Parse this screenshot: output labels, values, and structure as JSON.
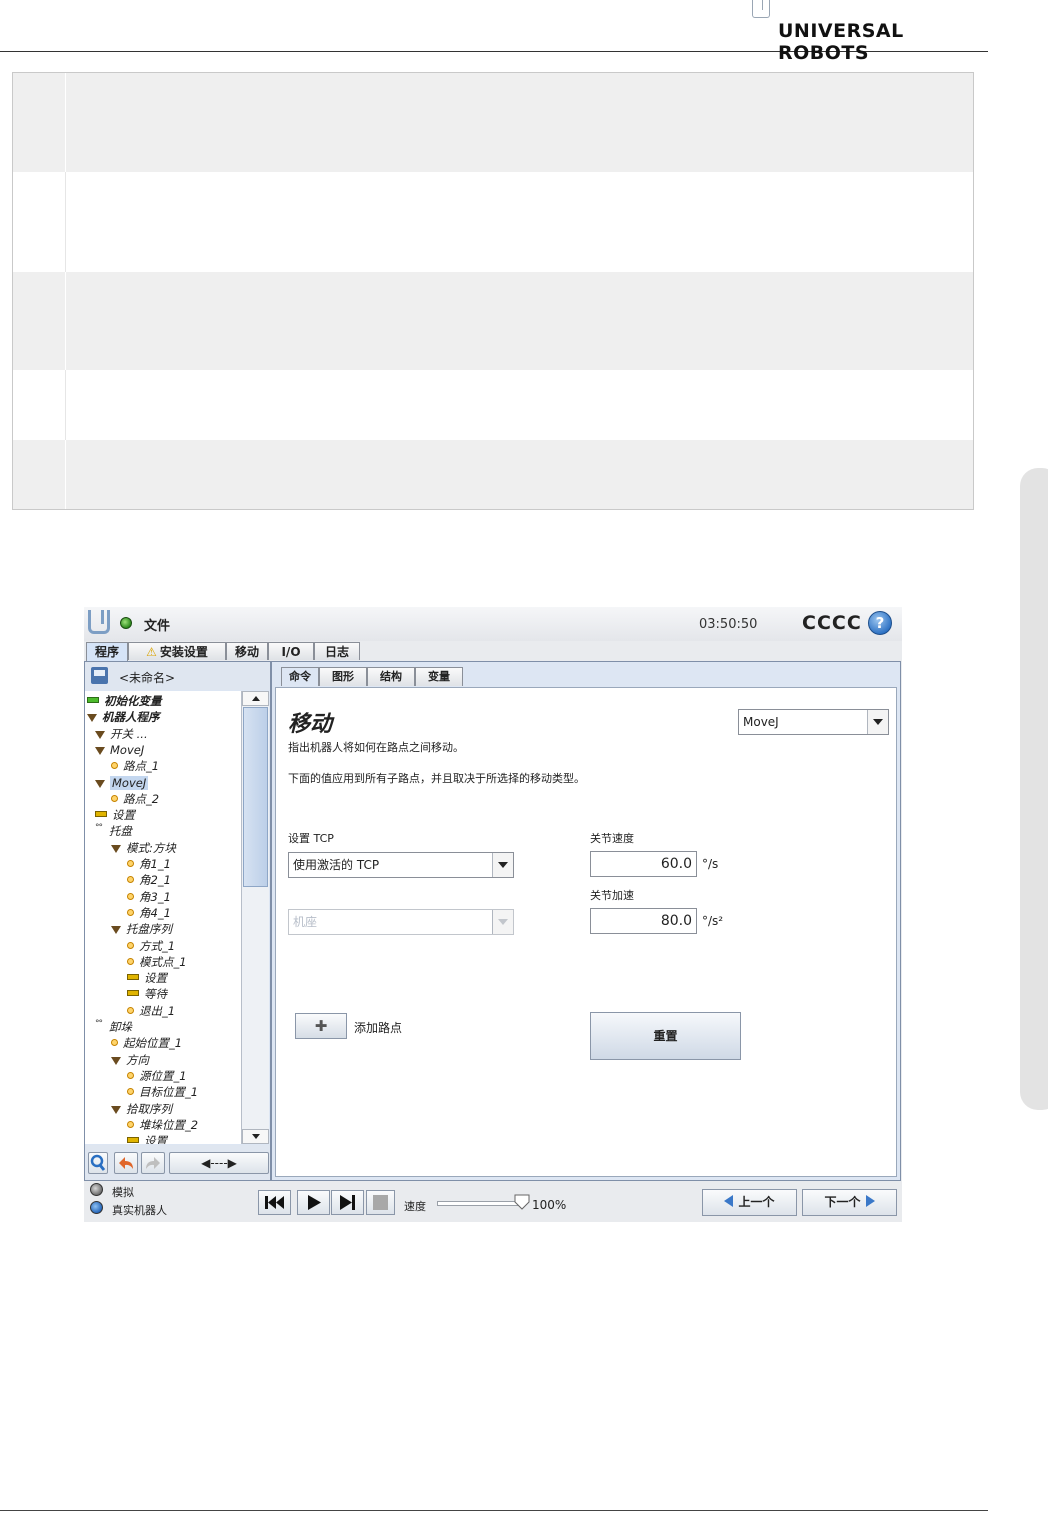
{
  "manual": {
    "brand": "UNIVERSAL ROBOTS"
  },
  "topbar": {
    "file_menu": "文件",
    "clock": "03:50:50",
    "robot_name": "CCCC",
    "help_symbol": "?"
  },
  "main_tabs": [
    {
      "label": "程序"
    },
    {
      "label": "安装设置",
      "warning": true
    },
    {
      "label": "移动"
    },
    {
      "label": "I/O"
    },
    {
      "label": "日志"
    }
  ],
  "program": {
    "name": "<未命名>"
  },
  "tree": [
    {
      "label": "初始化变量",
      "icon": "bar-green",
      "indent": 0,
      "bold": true
    },
    {
      "label": "机器人程序",
      "icon": "triangle",
      "indent": 0,
      "bold": true
    },
    {
      "label": "开关 ...",
      "icon": "triangle",
      "indent": 1
    },
    {
      "label": "MoveJ",
      "icon": "triangle",
      "indent": 1
    },
    {
      "label": "路点_1",
      "icon": "dot",
      "indent": 2
    },
    {
      "label": "MoveJ",
      "icon": "triangle",
      "indent": 1,
      "selected": true
    },
    {
      "label": "路点_2",
      "icon": "dot",
      "indent": 2
    },
    {
      "label": "设置",
      "icon": "bar",
      "indent": 1
    },
    {
      "label": "托盘",
      "icon": "node",
      "indent": 1
    },
    {
      "label": "模式:方块",
      "icon": "triangle",
      "indent": 2
    },
    {
      "label": "角1_1",
      "icon": "dot",
      "indent": 3
    },
    {
      "label": "角2_1",
      "icon": "dot",
      "indent": 3
    },
    {
      "label": "角3_1",
      "icon": "dot",
      "indent": 3
    },
    {
      "label": "角4_1",
      "icon": "dot",
      "indent": 3
    },
    {
      "label": "托盘序列",
      "icon": "triangle",
      "indent": 2
    },
    {
      "label": "方式_1",
      "icon": "dot",
      "indent": 3
    },
    {
      "label": "模式点_1",
      "icon": "dot",
      "indent": 3
    },
    {
      "label": "设置",
      "icon": "bar",
      "indent": 3
    },
    {
      "label": "等待",
      "icon": "bar",
      "indent": 3
    },
    {
      "label": "退出_1",
      "icon": "dot",
      "indent": 3
    },
    {
      "label": "卸垛",
      "icon": "node",
      "indent": 1
    },
    {
      "label": "起始位置_1",
      "icon": "dot",
      "indent": 2
    },
    {
      "label": "方向",
      "icon": "triangle",
      "indent": 2
    },
    {
      "label": "源位置_1",
      "icon": "dot",
      "indent": 3
    },
    {
      "label": "目标位置_1",
      "icon": "dot",
      "indent": 3
    },
    {
      "label": "拾取序列",
      "icon": "triangle",
      "indent": 2
    },
    {
      "label": "堆垛位置_2",
      "icon": "dot",
      "indent": 3
    },
    {
      "label": "设置",
      "icon": "bar",
      "indent": 3
    }
  ],
  "tree_tools": {
    "move_arrows": "◀----▶"
  },
  "sub_tabs": [
    {
      "label": "命令"
    },
    {
      "label": "图形"
    },
    {
      "label": "结构"
    },
    {
      "label": "变量"
    }
  ],
  "command": {
    "title": "移动",
    "desc1": "指出机器人将如何在路点之间移动。",
    "desc2": "下面的值应用到所有子路点，并且取决于所选择的移动类型。",
    "move_type": "MoveJ",
    "tcp_label": "设置 TCP",
    "tcp_value": "使用激活的 TCP",
    "feature_value": "机座",
    "joint_speed_label": "关节速度",
    "joint_speed_value": "60.0",
    "joint_speed_unit": "°/s",
    "joint_accel_label": "关节加速",
    "joint_accel_value": "80.0",
    "joint_accel_unit": "°/s²",
    "add_waypoint_symbol": "✚",
    "add_waypoint_label": "添加路点",
    "reset_label": "重置"
  },
  "bottom": {
    "sim_label": "模拟",
    "real_label": "真实机器人",
    "speed_label": "速度",
    "speed_value": "100%",
    "speed_fraction": 1.0,
    "prev_label": "上一个",
    "next_label": "下一个"
  },
  "colors": {
    "accent_blue": "#3a78c8",
    "panel_bg": "#dde6f3",
    "status_green": "#2c8a1c"
  }
}
